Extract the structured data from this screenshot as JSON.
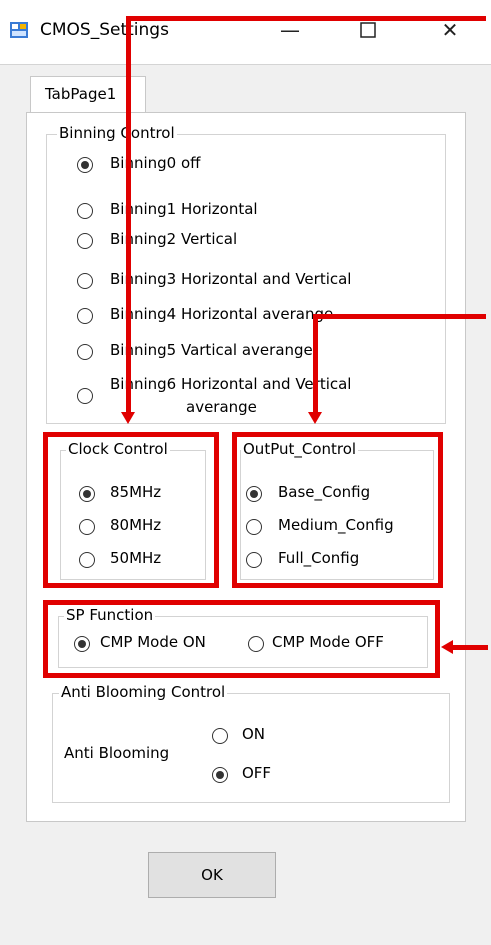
{
  "window": {
    "title": "CMOS_Settings"
  },
  "tab": {
    "label": "TabPage1"
  },
  "binning": {
    "title": "Binning Control",
    "options": [
      "Binning0 off",
      "Binning1 Horizontal",
      "Binning2 Vertical",
      "Binning3 Horizontal and Vertical",
      "Binning4 Horizontal  averange",
      "Binning5 Vartical  averange"
    ],
    "option6_line1": "Binning6 Horizontal and Vertical",
    "option6_line2": "averange",
    "selected": "Binning0 off"
  },
  "clock": {
    "title": "Clock Control",
    "options": [
      "85MHz",
      "80MHz",
      "50MHz"
    ],
    "selected": "85MHz"
  },
  "output": {
    "title": "OutPut_Control",
    "options": [
      "Base_Config",
      "Medium_Config",
      "Full_Config"
    ],
    "selected": "Base_Config"
  },
  "sp": {
    "title": "SP Function",
    "options": [
      "CMP Mode ON",
      "CMP Mode OFF"
    ],
    "selected": "CMP Mode ON"
  },
  "anti": {
    "title": "Anti Blooming Control",
    "label": "Anti Blooming",
    "options": [
      "ON",
      "OFF"
    ],
    "selected": "OFF"
  },
  "ok_label": "OK",
  "colors": {
    "annotation": "#e00000",
    "window_bg": "#f0f0f0",
    "panel_bg": "#ffffff"
  }
}
